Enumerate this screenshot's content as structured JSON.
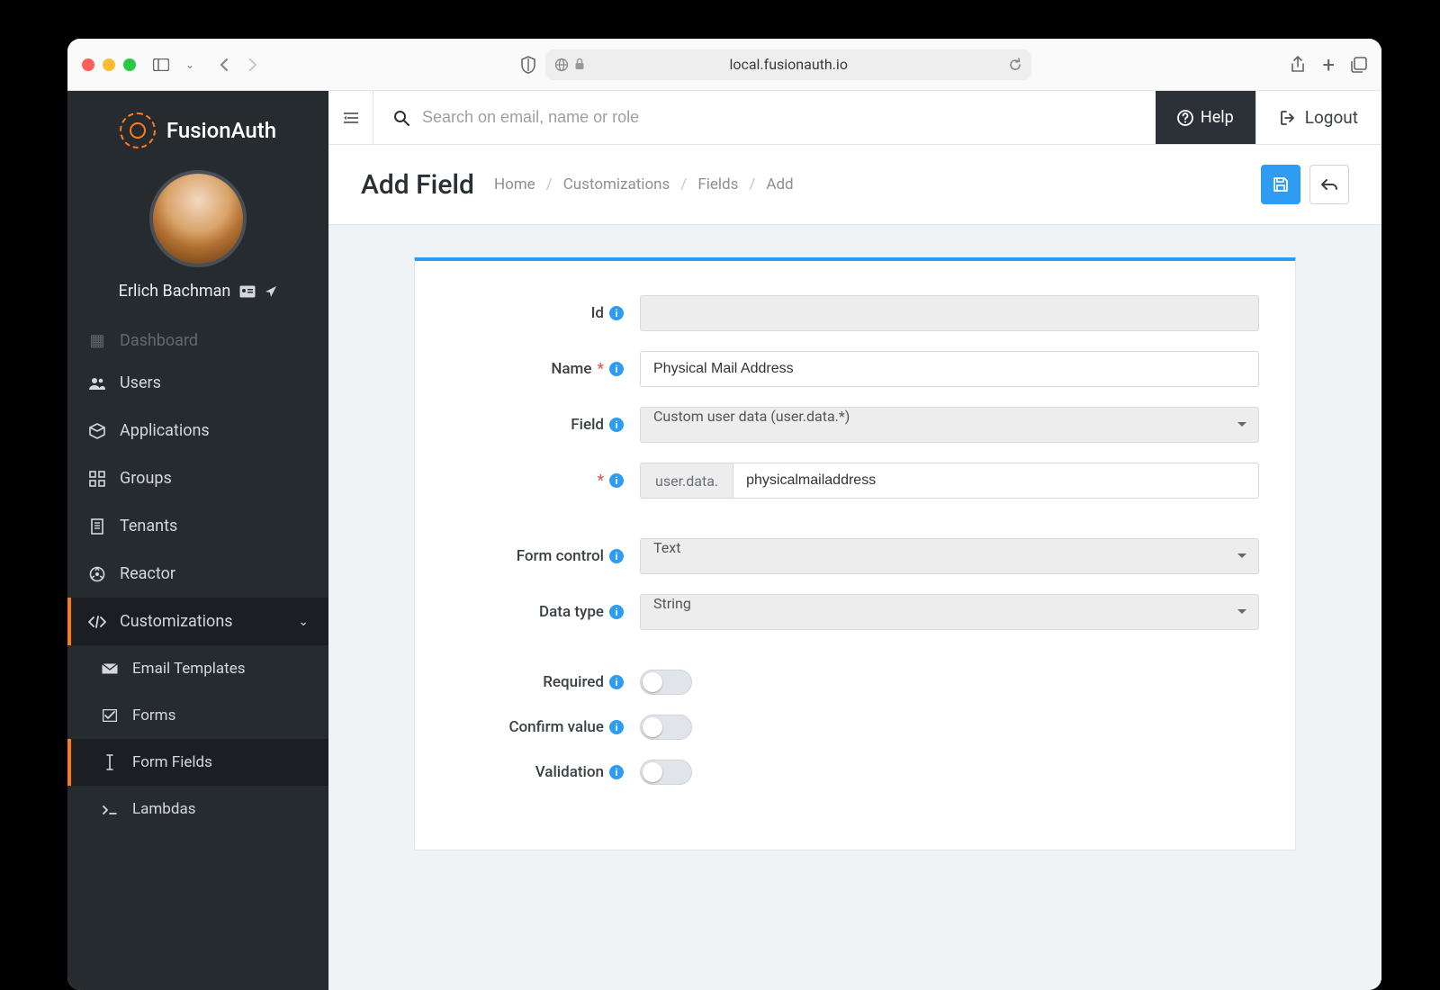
{
  "browser": {
    "url": "local.fusionauth.io"
  },
  "brand": {
    "name": "FusionAuth"
  },
  "user": {
    "name": "Erlich Bachman"
  },
  "sidebar": {
    "items": [
      {
        "label": "Dashboard"
      },
      {
        "label": "Users"
      },
      {
        "label": "Applications"
      },
      {
        "label": "Groups"
      },
      {
        "label": "Tenants"
      },
      {
        "label": "Reactor"
      },
      {
        "label": "Customizations"
      }
    ],
    "subitems": [
      {
        "label": "Email Templates"
      },
      {
        "label": "Forms"
      },
      {
        "label": "Form Fields"
      },
      {
        "label": "Lambdas"
      }
    ]
  },
  "topbar": {
    "search_placeholder": "Search on email, name or role",
    "help": "Help",
    "logout": "Logout"
  },
  "page": {
    "title": "Add Field",
    "breadcrumb": [
      "Home",
      "Customizations",
      "Fields",
      "Add"
    ]
  },
  "form": {
    "labels": {
      "id": "Id",
      "name": "Name",
      "field": "Field",
      "form_control": "Form control",
      "data_type": "Data type",
      "required": "Required",
      "confirm_value": "Confirm value",
      "validation": "Validation"
    },
    "values": {
      "id": "",
      "name": "Physical Mail Address",
      "field": "Custom user data (user.data.*)",
      "key_prefix": "user.data.",
      "key_value": "physicalmailaddress",
      "form_control": "Text",
      "data_type": "String"
    }
  }
}
